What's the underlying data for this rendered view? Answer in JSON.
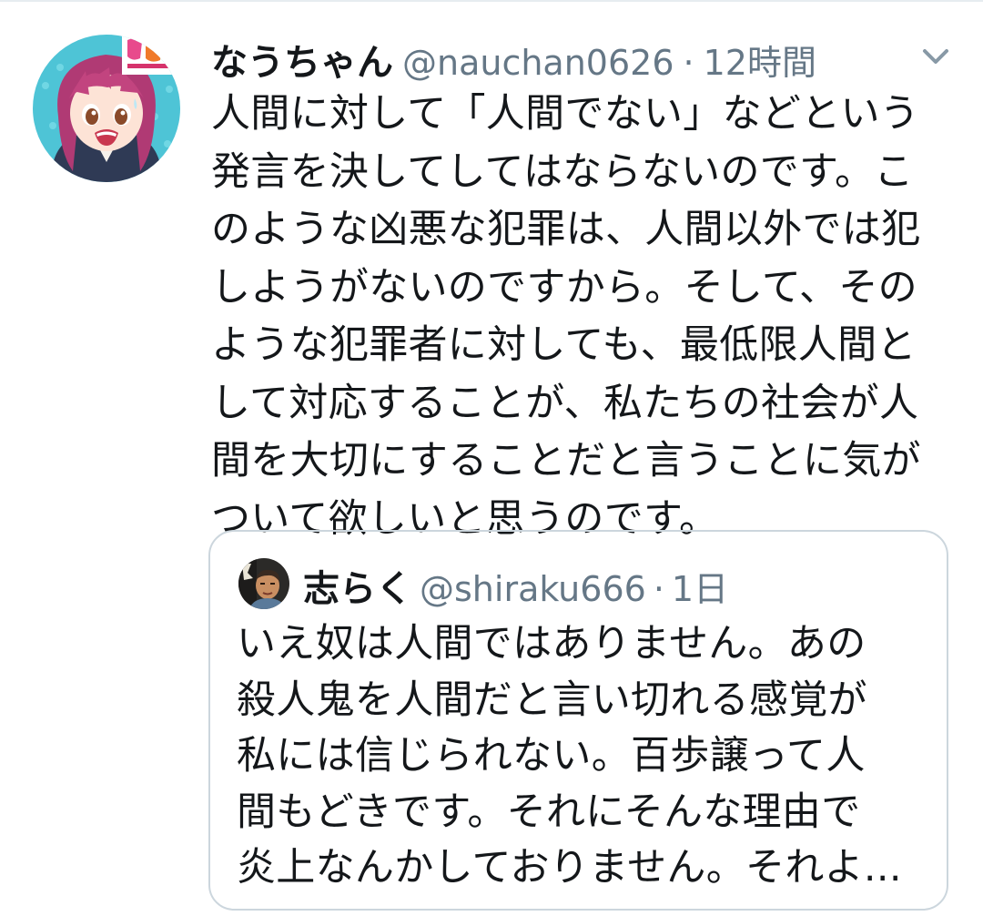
{
  "tweet": {
    "display_name": "なうちゃん",
    "handle": "@nauchan0626",
    "separator": "·",
    "time": "12時間",
    "text_lines": [
      "人間に対して「人間でない」などという",
      "発言を決してしてはならないのです。こ",
      "のような凶悪な犯罪は、人間以外では犯",
      "しようがないのですから。そして、その",
      "ような犯罪者に対しても、最低限人間と",
      "して対応することが、私たちの社会が人",
      "間を大切にすることだと言うことに気が",
      "ついて欲しいと思うのです。"
    ],
    "avatar_icon": "anime-girl-avatar",
    "menu_icon": "chevron-down-icon"
  },
  "quoted_tweet": {
    "display_name": "志らく",
    "handle": "@shiraku666",
    "separator": "·",
    "time": "1日",
    "text_lines": [
      "いえ奴は人間ではありません。あの",
      "殺人鬼を人間だと言い切れる感覚が",
      "私には信じられない。百歩譲って人",
      "間もどきです。それにそんな理由で",
      "炎上なんかしておりません。それよ..."
    ],
    "avatar_icon": "man-photo-avatar"
  },
  "colors": {
    "text": "#14171a",
    "secondary": "#657786",
    "border": "#ccd6dd"
  }
}
